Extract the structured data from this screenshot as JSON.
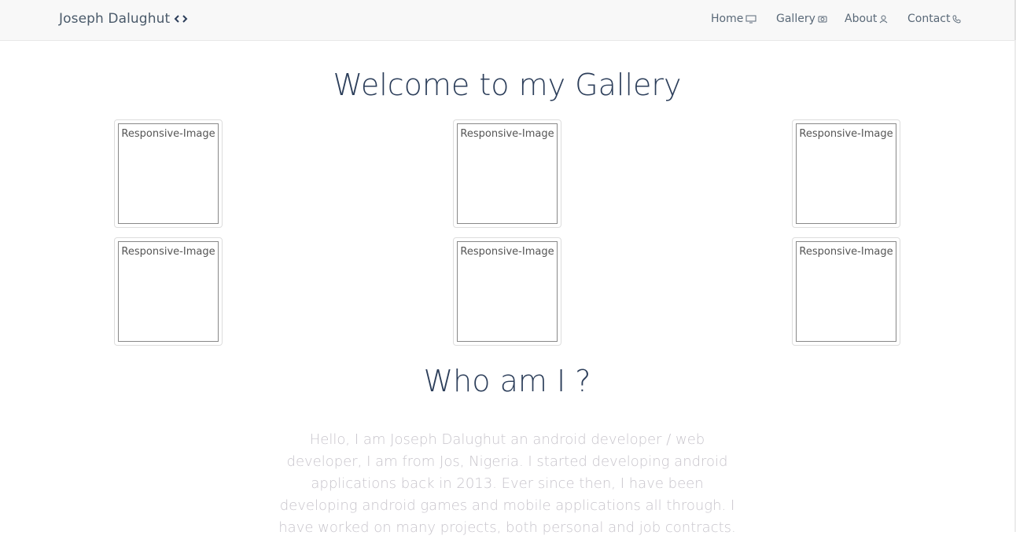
{
  "navbar": {
    "brand": "Joseph Dalughut",
    "brand_icon": "code-icon",
    "links": [
      {
        "label": "Home",
        "icon": "monitor-icon"
      },
      {
        "label": "Gallery",
        "icon": "camera-icon"
      },
      {
        "label": "About",
        "icon": "user-icon"
      },
      {
        "label": "Contact",
        "icon": "phone-icon"
      }
    ]
  },
  "gallery": {
    "title": "Welcome to my Gallery",
    "images": [
      {
        "alt": "Responsive-Image"
      },
      {
        "alt": "Responsive-Image"
      },
      {
        "alt": "Responsive-Image"
      },
      {
        "alt": "Responsive-Image"
      },
      {
        "alt": "Responsive-Image"
      },
      {
        "alt": "Responsive-Image"
      }
    ]
  },
  "about": {
    "title": "Who am I ?",
    "bio": "Hello, I am Joseph Dalughut an android developer / web developer, I am from Jos, Nigeria. I started developing android applications back in 2013. Ever since then, I have been developing android games and mobile applications all through. I have worked on many projects, both personal and job contracts."
  },
  "colors": {
    "heading": "#2c3e5a",
    "navbar_bg": "#f8f8f8",
    "bio_text": "#c8c5cc"
  }
}
